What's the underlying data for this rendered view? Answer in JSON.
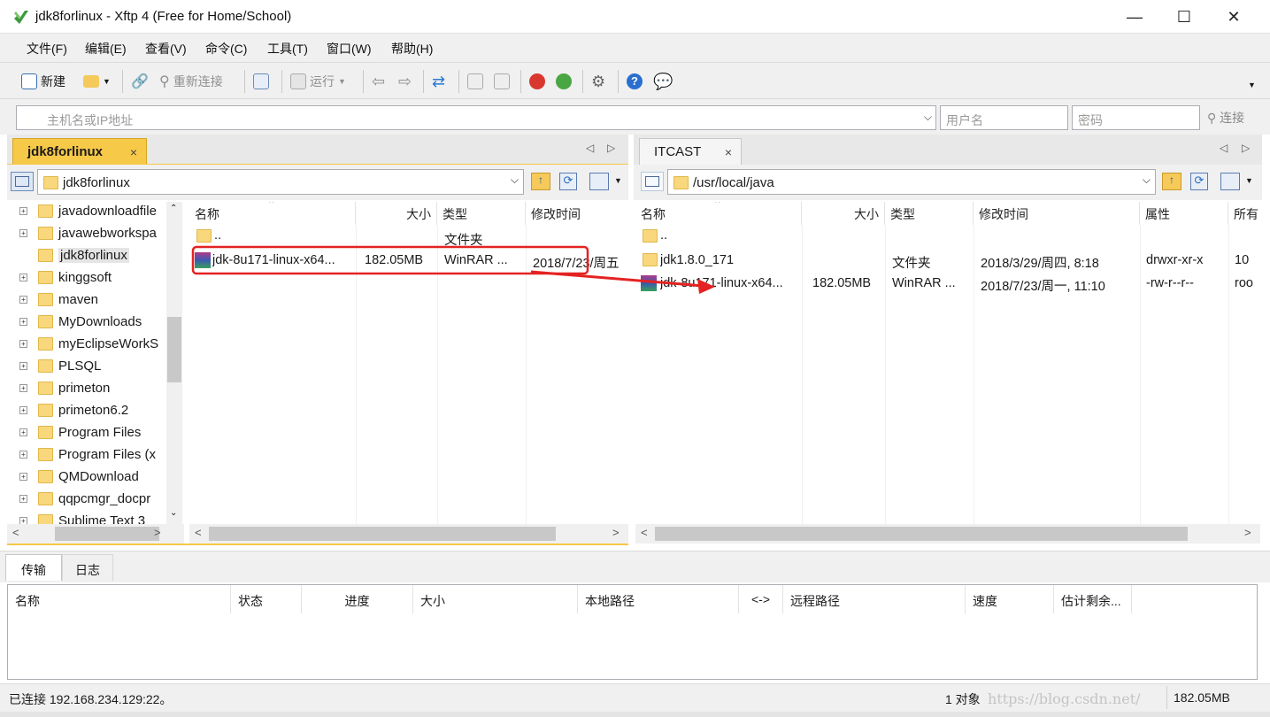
{
  "window": {
    "title": "jdk8forlinux - Xftp 4 (Free for Home/School)",
    "minimize": "—",
    "maximize": "☐",
    "close": "✕"
  },
  "menu": [
    "文件(F)",
    "编辑(E)",
    "查看(V)",
    "命令(C)",
    "工具(T)",
    "窗口(W)",
    "帮助(H)"
  ],
  "toolbar": {
    "new_label": "新建",
    "reconnect_label": "重新连接",
    "run_label": "运行"
  },
  "address": {
    "host_placeholder": "主机名或IP地址",
    "user_placeholder": "用户名",
    "password_placeholder": "密码",
    "connect_label": "连接"
  },
  "left_pane": {
    "tab_label": "jdk8forlinux",
    "tab_close": "×",
    "path": "jdk8forlinux",
    "tree": [
      "javadownloadfile",
      "javawebworkspa",
      "jdk8forlinux",
      "kinggsoft",
      "maven",
      "MyDownloads",
      "myEclipseWorkS",
      "PLSQL",
      "primeton",
      "primeton6.2",
      "Program Files",
      "Program Files (x",
      "QMDownload",
      "qqpcmgr_docpr",
      "Sublime Text 3"
    ],
    "columns": [
      "名称",
      "大小",
      "类型",
      "修改时间"
    ],
    "rows": [
      {
        "name": "..",
        "size": "",
        "type": "文件夹",
        "modified": ""
      },
      {
        "name": "jdk-8u171-linux-x64...",
        "size": "182.05MB",
        "type": "WinRAR ...",
        "modified": "2018/7/23/周五"
      }
    ]
  },
  "right_pane": {
    "tab_label": "ITCAST",
    "tab_close": "×",
    "path": "/usr/local/java",
    "columns": [
      "名称",
      "大小",
      "类型",
      "修改时间",
      "属性",
      "所有"
    ],
    "rows": [
      {
        "name": "..",
        "size": "",
        "type": "",
        "modified": "",
        "attrs": "",
        "owner": ""
      },
      {
        "name": "jdk1.8.0_171",
        "size": "",
        "type": "文件夹",
        "modified": "2018/3/29/周四, 8:18",
        "attrs": "drwxr-xr-x",
        "owner": "10"
      },
      {
        "name": "jdk-8u171-linux-x64...",
        "size": "182.05MB",
        "type": "WinRAR ...",
        "modified": "2018/7/23/周一, 11:10",
        "attrs": "-rw-r--r--",
        "owner": "roo"
      }
    ]
  },
  "bottom_tabs": [
    "传输",
    "日志"
  ],
  "transfer_columns": [
    "名称",
    "状态",
    "进度",
    "大小",
    "本地路径",
    "<->",
    "远程路径",
    "速度",
    "估计剩余..."
  ],
  "status": {
    "left": "已连接 192.168.234.129:22。",
    "count": "1 对象",
    "size": "182.05MB",
    "watermark": "https://blog.csdn.net/"
  },
  "colors": {
    "active_tab": "#f7c948",
    "annotation": "#e52222"
  }
}
